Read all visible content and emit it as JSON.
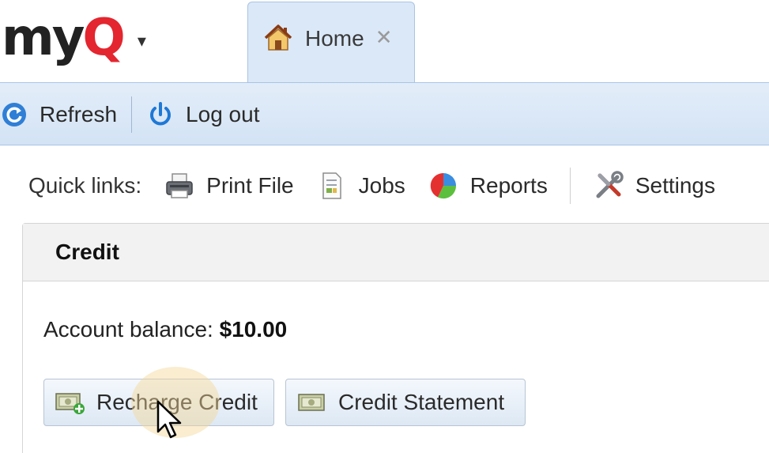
{
  "app": {
    "logo": {
      "part1": "my",
      "part2": "Q"
    }
  },
  "tabs": [
    {
      "label": "Home",
      "icon": "house-icon",
      "active": true
    }
  ],
  "toolbar": {
    "refresh_label": "Refresh",
    "logout_label": "Log out"
  },
  "quick_links": {
    "label": "Quick links:",
    "items": [
      {
        "label": "Print File",
        "icon": "printer-icon"
      },
      {
        "label": "Jobs",
        "icon": "document-icon"
      },
      {
        "label": "Reports",
        "icon": "pie-chart-icon"
      },
      {
        "label": "Settings",
        "icon": "tools-icon"
      }
    ]
  },
  "credit": {
    "title": "Credit",
    "balance_label": "Account balance:",
    "balance_value": "$10.00",
    "recharge_label": "Recharge Credit",
    "statement_label": "Credit Statement"
  },
  "colors": {
    "accent_blue": "#dbe8f8",
    "logo_red": "#e3262f",
    "toolbar_blue": "#d3e3f5"
  }
}
